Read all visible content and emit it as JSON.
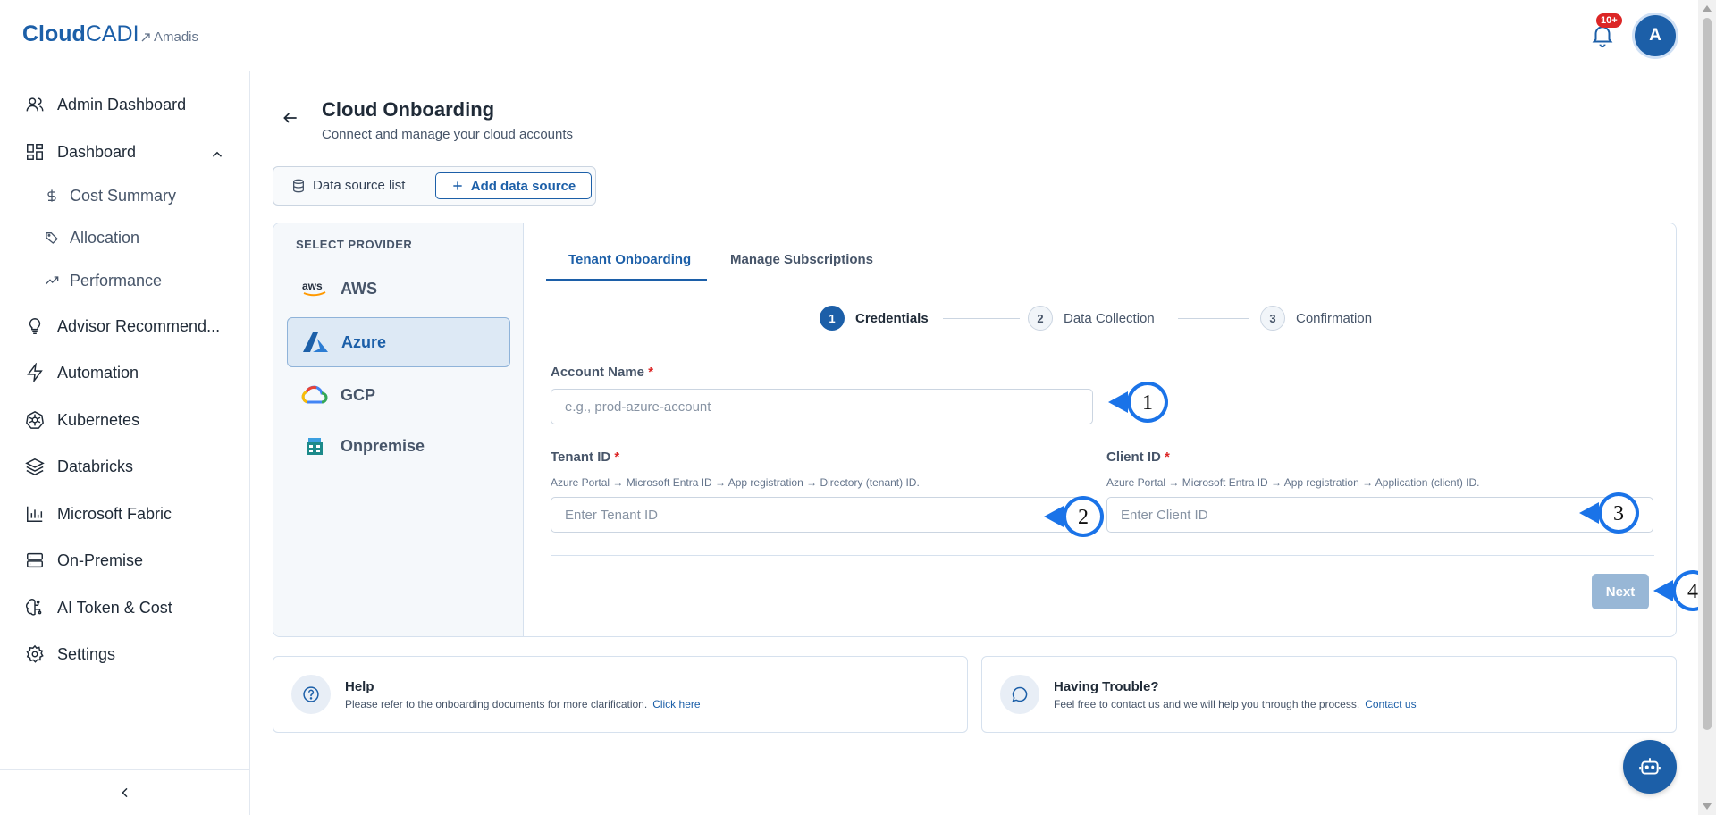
{
  "brand": {
    "part1": "Cloud",
    "part2": "CADI",
    "tenant": "Amadis"
  },
  "header": {
    "notif_badge": "10+",
    "avatar_initial": "A"
  },
  "sidebar": {
    "items": [
      {
        "label": "Admin Dashboard",
        "icon": "users-icon"
      },
      {
        "label": "Dashboard",
        "icon": "dashboard-icon"
      },
      {
        "label": "Advisor Recommend...",
        "icon": "lightbulb-icon"
      },
      {
        "label": "Automation",
        "icon": "bolt-icon"
      },
      {
        "label": "Kubernetes",
        "icon": "kubernetes-icon"
      },
      {
        "label": "Databricks",
        "icon": "layers-icon"
      },
      {
        "label": "Microsoft Fabric",
        "icon": "bar-chart-icon"
      },
      {
        "label": "On-Premise",
        "icon": "server-icon"
      },
      {
        "label": "AI Token & Cost",
        "icon": "ai-brain-icon"
      },
      {
        "label": "Settings",
        "icon": "gear-icon"
      }
    ],
    "sub_items": [
      {
        "label": "Cost Summary",
        "icon": "dollar-icon"
      },
      {
        "label": "Allocation",
        "icon": "tag-icon"
      },
      {
        "label": "Performance",
        "icon": "trend-icon"
      }
    ]
  },
  "page": {
    "title": "Cloud Onboarding",
    "subtitle": "Connect and manage your cloud accounts"
  },
  "ds_tabs": {
    "list": "Data source list",
    "add": "Add data source"
  },
  "providers": {
    "heading": "SELECT PROVIDER",
    "items": [
      "AWS",
      "Azure",
      "GCP",
      "Onpremise"
    ],
    "selected": "Azure"
  },
  "tabs": {
    "tenant": "Tenant Onboarding",
    "manage": "Manage Subscriptions"
  },
  "steps": [
    {
      "num": "1",
      "label": "Credentials"
    },
    {
      "num": "2",
      "label": "Data Collection"
    },
    {
      "num": "3",
      "label": "Confirmation"
    }
  ],
  "form": {
    "account_name": {
      "label": "Account Name",
      "placeholder": "e.g., prod-azure-account",
      "value": ""
    },
    "tenant_id": {
      "label": "Tenant ID",
      "hint": "Azure Portal → Microsoft Entra ID → App registration → Directory (tenant) ID.",
      "placeholder": "Enter Tenant ID",
      "value": ""
    },
    "client_id": {
      "label": "Client ID",
      "hint": "Azure Portal → Microsoft Entra ID → App registration → Application (client) ID.",
      "placeholder": "Enter Client ID",
      "value": ""
    },
    "required_mark": "*",
    "next": "Next"
  },
  "help": {
    "title": "Help",
    "text": "Please refer to the onboarding documents for more clarification.",
    "link": "Click here"
  },
  "trouble": {
    "title": "Having Trouble?",
    "text": "Feel free to contact us and we will help you through the process.",
    "link": "Contact us"
  },
  "callouts": [
    "1",
    "2",
    "3",
    "4"
  ],
  "colors": {
    "accent": "#1c5fa8",
    "callout": "#1a73e8",
    "danger": "#dc2626"
  }
}
